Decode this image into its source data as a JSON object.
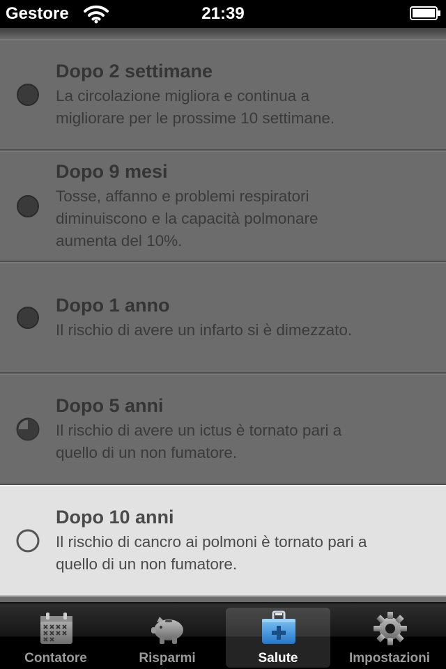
{
  "status_bar": {
    "carrier": "Gestore",
    "time": "21:39"
  },
  "milestones": [
    {
      "title": "Dopo 2 settimane",
      "lines": [
        "La circolazione migliora e continua a",
        "migliorare per le prossime 10 settimane."
      ],
      "status": "completed",
      "progress": 1.0
    },
    {
      "title": "Dopo 9 mesi",
      "lines": [
        "Tosse, affanno e problemi respiratori",
        "diminuiscono e la capacità polmonare",
        "aumenta del 10%."
      ],
      "status": "completed",
      "progress": 1.0
    },
    {
      "title": "Dopo 1 anno",
      "lines": [
        "Il rischio di avere un infarto si è dimezzato."
      ],
      "status": "completed",
      "progress": 1.0
    },
    {
      "title": "Dopo 5 anni",
      "lines": [
        "Il rischio di avere un ictus è tornato pari a",
        "quello di un non fumatore."
      ],
      "status": "in-progress",
      "progress": 0.75
    },
    {
      "title": "Dopo 10 anni",
      "lines": [
        "Il rischio di cancro ai polmoni è tornato pari a",
        "quello di un non fumatore."
      ],
      "status": "pending",
      "progress": 0.0
    }
  ],
  "tabs": [
    {
      "label": "Contatore",
      "icon": "calendar-icon",
      "active": false
    },
    {
      "label": "Risparmi",
      "icon": "piggy-bank-icon",
      "active": false
    },
    {
      "label": "Salute",
      "icon": "first-aid-kit-icon",
      "active": true
    },
    {
      "label": "Impostazioni",
      "icon": "gear-icon",
      "active": false
    }
  ],
  "colors": {
    "past_row": "#6c6c6c",
    "current_row": "#e2e2e2",
    "tab_active_label": "#ffffff",
    "tab_inactive_label": "#9a9a9a",
    "kit_blue": "#3b8fd9"
  }
}
